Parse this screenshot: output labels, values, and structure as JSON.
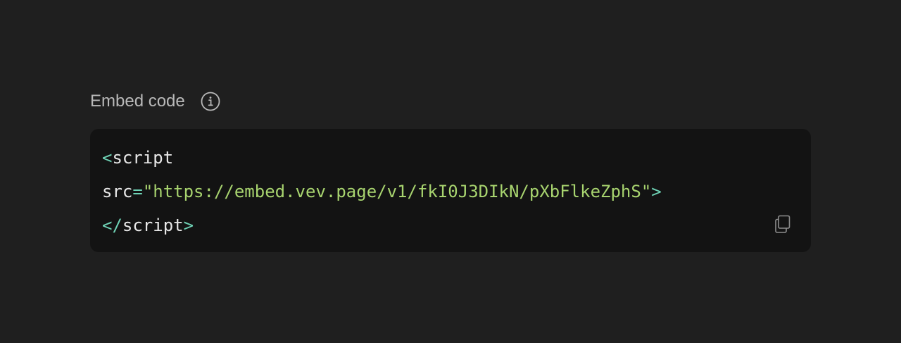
{
  "embed": {
    "label": "Embed code",
    "info_icon": "info-icon",
    "copy_icon": "copy-icon",
    "code": {
      "line1_open": "<",
      "line1_tag": "script",
      "line2_attr": "src",
      "line2_eq": "=",
      "line2_value": "\"https://embed.vev.page/v1/fkI0J3DIkN/pXbFlkeZphS\"",
      "line2_close": ">",
      "line3_open": "</",
      "line3_tag": "script",
      "line3_close": ">"
    }
  },
  "colors": {
    "background": "#1f1f1f",
    "code_background": "#131313",
    "label": "#b9b9b9",
    "tag": "#6fd3b6",
    "string": "#a8d46f",
    "text": "#e8e8e8"
  }
}
